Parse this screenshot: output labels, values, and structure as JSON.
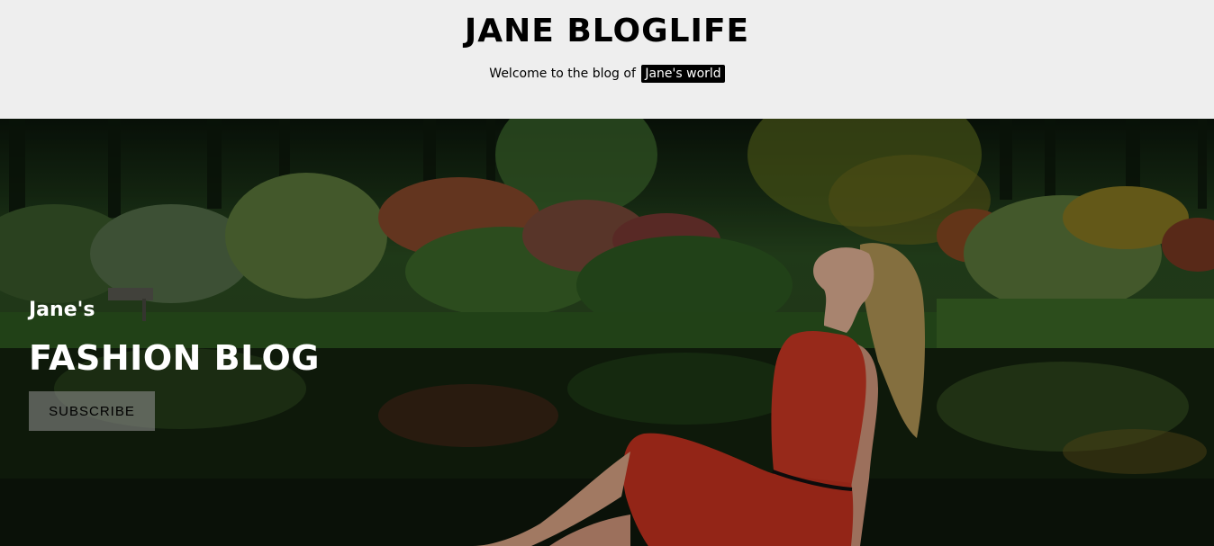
{
  "header": {
    "title": "JANE BLOGLIFE",
    "tagline_prefix": "Welcome to the blog of",
    "tagline_highlight": "Jane's world"
  },
  "hero": {
    "kicker": "Jane's",
    "title": "FASHION BLOG",
    "subscribe_label": "SUBSCRIBE"
  },
  "colors": {
    "header_background": "#eeeeee",
    "highlight_background": "#000000",
    "dress_red": "#d23a25"
  }
}
